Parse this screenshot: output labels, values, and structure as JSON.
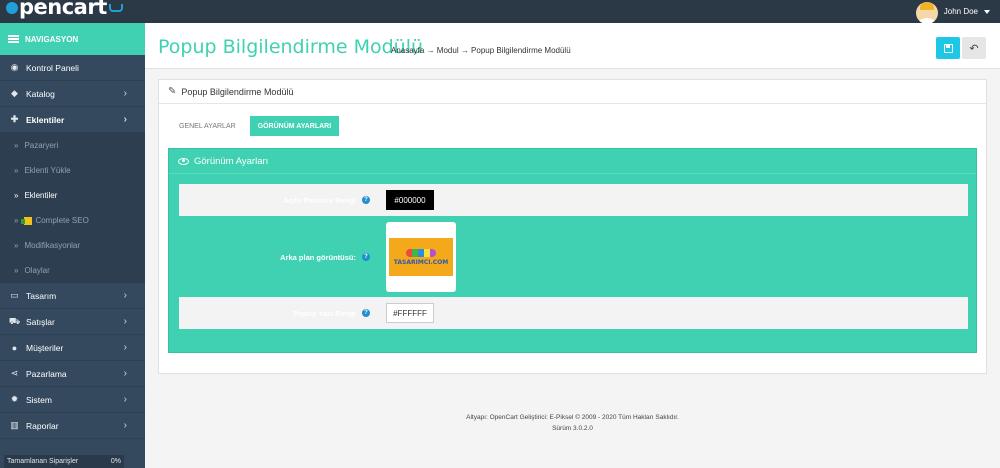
{
  "brand": {
    "logo_text": "pencart",
    "accent": "#3fd1b1"
  },
  "user": {
    "name": "John Doe"
  },
  "sidebar": {
    "header": "NAVIGASYON",
    "items": [
      {
        "label": "Kontrol Paneli",
        "icon": "dashboard-icon"
      },
      {
        "label": "Katalog",
        "icon": "tag-icon"
      },
      {
        "label": "Eklentiler",
        "icon": "puzzle-icon"
      }
    ],
    "sub_items": [
      {
        "label": "Pazaryeri"
      },
      {
        "label": "Eklenti Yükle"
      },
      {
        "label": "Eklentiler"
      },
      {
        "label": "Complete SEO"
      },
      {
        "label": "Modifikasyonlar"
      },
      {
        "label": "Olaylar"
      }
    ],
    "items_after": [
      {
        "label": "Tasarım",
        "icon": "desktop-icon"
      },
      {
        "label": "Satışlar",
        "icon": "cart-icon"
      },
      {
        "label": "Müşteriler",
        "icon": "user-icon"
      },
      {
        "label": "Pazarlama",
        "icon": "share-icon"
      },
      {
        "label": "Sistem",
        "icon": "gear-icon"
      },
      {
        "label": "Raporlar",
        "icon": "bar-chart-icon"
      }
    ],
    "progress": {
      "label": "Tamamlanan Siparişler",
      "value": "0%"
    }
  },
  "page": {
    "title": "Popup Bilgilendirme Modülü",
    "breadcrumb": "Anasayfa → Modul → Popup Bilgilendirme Modülü",
    "save_icon": "save-icon",
    "back_icon": "reply-icon"
  },
  "panel": {
    "title": "Popup Bilgilendirme Modülü",
    "tabs": [
      {
        "label": "GENEL AYARLAR"
      },
      {
        "label": "GÖRÜNÜM AYARLARI"
      }
    ],
    "section_title": "Görünüm Ayarları",
    "fields": {
      "bg_color": {
        "label": "Açılır Pencere Rengi",
        "value": "#000000"
      },
      "bg_image": {
        "label": "Arka plan görüntüsü:",
        "image_text": "TASARIMCI.COM"
      },
      "text_color": {
        "label": "Popup Yazı Rengi",
        "value": "#FFFFFF"
      }
    }
  },
  "footer": {
    "line1": "Altyapı: OpenCart Geliştirici: E-Piksel © 2009 - 2020 Tüm Hakları Saklıdır.",
    "line2": "Sürüm 3.0.2.0"
  }
}
